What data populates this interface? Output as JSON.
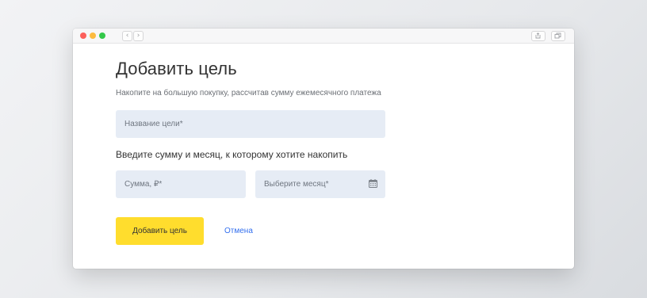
{
  "colors": {
    "accent_button": "#ffdd2d",
    "link": "#336fee",
    "field_bg": "#e6ecf5"
  },
  "browser": {
    "back_icon": "chevron-left-icon",
    "forward_icon": "chevron-right-icon",
    "share_icon": "share-icon",
    "tabs_icon": "tabs-icon"
  },
  "form": {
    "title": "Добавить цель",
    "subtitle": "Накопите на большую покупку, рассчитав сумму ежемесячного платежа",
    "goal_name_placeholder": "Название цели*",
    "section_heading": "Введите сумму и месяц, к которому хотите накопить",
    "amount_placeholder": "Сумма, ₽*",
    "month_placeholder": "Выберите месяц*",
    "month_icon": "calendar-icon",
    "submit_label": "Добавить цель",
    "cancel_label": "Отмена"
  }
}
